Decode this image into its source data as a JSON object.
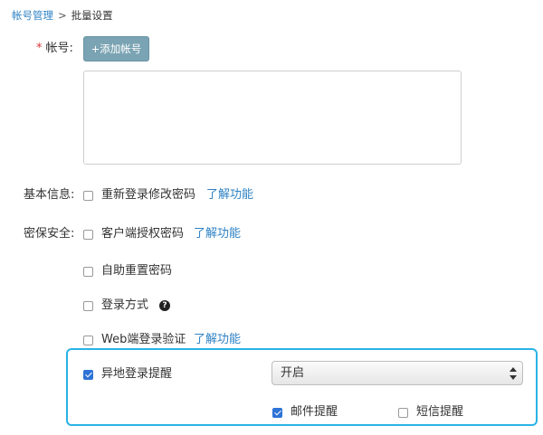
{
  "breadcrumb": {
    "parent": "帐号管理",
    "separator": ">",
    "current": "批量设置"
  },
  "account": {
    "required_mark": "*",
    "label": "帐号:",
    "add_button": "+添加帐号",
    "textarea_value": ""
  },
  "basic_info": {
    "label": "基本信息:",
    "options": [
      {
        "label": "重新登录修改密码",
        "checked": false,
        "learn_more": "了解功能"
      }
    ]
  },
  "security": {
    "label": "密保安全:",
    "options": [
      {
        "label": "客户端授权密码",
        "checked": false,
        "learn_more": "了解功能"
      },
      {
        "label": "自助重置密码",
        "checked": false
      },
      {
        "label": "登录方式",
        "checked": false,
        "help_icon": "question-circle-icon"
      },
      {
        "label": "Web端登录验证",
        "checked": false,
        "learn_more": "了解功能"
      }
    ]
  },
  "remote_login": {
    "label": "异地登录提醒",
    "checked": true,
    "select_value": "开启",
    "sub_options": [
      {
        "label": "邮件提醒",
        "checked": true
      },
      {
        "label": "短信提醒",
        "checked": false
      }
    ]
  },
  "colors": {
    "link": "#2f82c4",
    "highlight_border": "#29b3e6",
    "checkbox_checked": "#2e73d6",
    "button": "#7aa3b3",
    "required": "#d9383a"
  }
}
